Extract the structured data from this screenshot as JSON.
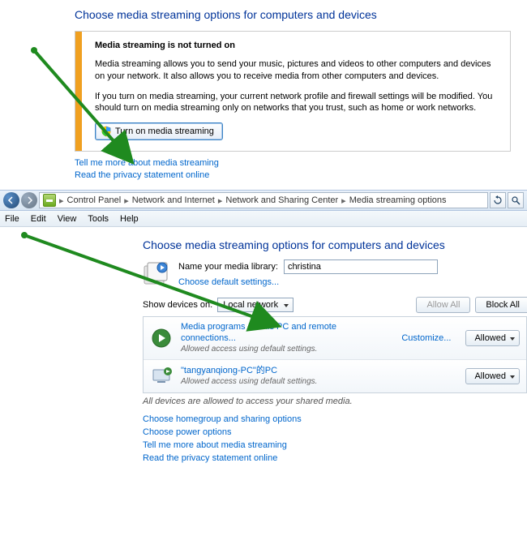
{
  "top": {
    "heading": "Choose media streaming options for computers and devices",
    "warning": {
      "title": "Media streaming is not turned on",
      "para1": "Media streaming allows you to send your music, pictures and videos to other computers and devices on your network.  It also allows you to receive media from other computers and devices.",
      "para2": "If you turn on media streaming, your current network profile and firewall settings will be modified. You should turn on media streaming only on networks that you trust, such as home or work networks.",
      "button_label": "Turn on media streaming"
    },
    "links": {
      "more": "Tell me more about media streaming",
      "privacy": "Read the privacy statement online"
    }
  },
  "breadcrumb": {
    "items": [
      "Control Panel",
      "Network and Internet",
      "Network and Sharing Center",
      "Media streaming options"
    ]
  },
  "menu": [
    "File",
    "Edit",
    "View",
    "Tools",
    "Help"
  ],
  "lower": {
    "heading": "Choose media streaming options for computers and devices",
    "library_label": "Name your media library:",
    "library_value": "christina",
    "default_settings": "Choose default settings...",
    "show_devices_label": "Show devices on:",
    "show_devices_value": "Local network",
    "allow_all": "Allow All",
    "block_all": "Block All",
    "customize": "Customize...",
    "allowed": "Allowed",
    "devices": [
      {
        "title": "Media programs on this PC and remote connections...",
        "sub": "Allowed access using default settings."
      },
      {
        "title": "\"tangyanqiong-PC\"的PC",
        "sub": "Allowed access using default settings."
      }
    ],
    "status": "All devices are allowed to access your shared media.",
    "links": {
      "homegroup": "Choose homegroup and sharing options",
      "power": "Choose power options",
      "more": "Tell me more about media streaming",
      "privacy": "Read the privacy statement online"
    }
  }
}
